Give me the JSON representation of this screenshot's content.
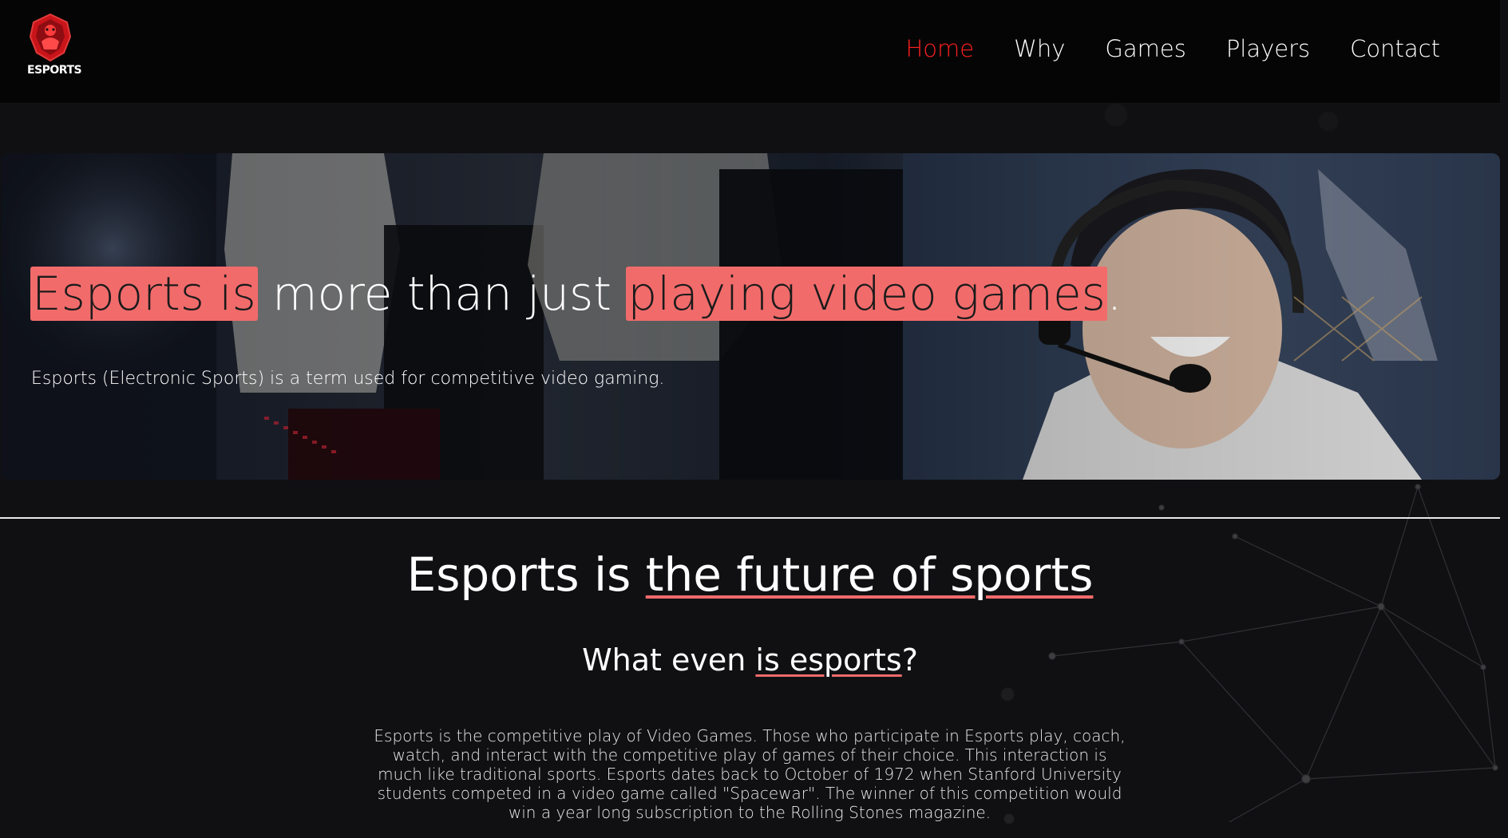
{
  "brand": {
    "logo_text": "ESPORTS",
    "accent_color": "#ff1f1f",
    "highlight_color": "#f26b6b"
  },
  "nav": {
    "items": [
      {
        "label": "Home",
        "active": true
      },
      {
        "label": "Why",
        "active": false
      },
      {
        "label": "Games",
        "active": false
      },
      {
        "label": "Players",
        "active": false
      },
      {
        "label": "Contact",
        "active": false
      }
    ]
  },
  "hero": {
    "title_part1": "Esports is",
    "title_part2": " more than just ",
    "title_part3": "playing video games",
    "title_part4": ".",
    "subtitle": "Esports (Electronic Sports) is a term used for competitive video gaming."
  },
  "section": {
    "title_plain": "Esports is ",
    "title_underlined": "the future of sports",
    "subheading_plain": "What even ",
    "subheading_underlined": "is esports",
    "subheading_end": "?",
    "paragraph": "Esports is the competitive play of Video Games. Those who participate in Esports play, coach, watch, and interact with the competitive play of games of their choice. This interaction is much like traditional sports. Esports dates back to October of 1972 when Stanford University students competed in a video game called \"Spacewar\". The winner of this competition would win a year long subscription to the Rolling Stones magazine."
  }
}
